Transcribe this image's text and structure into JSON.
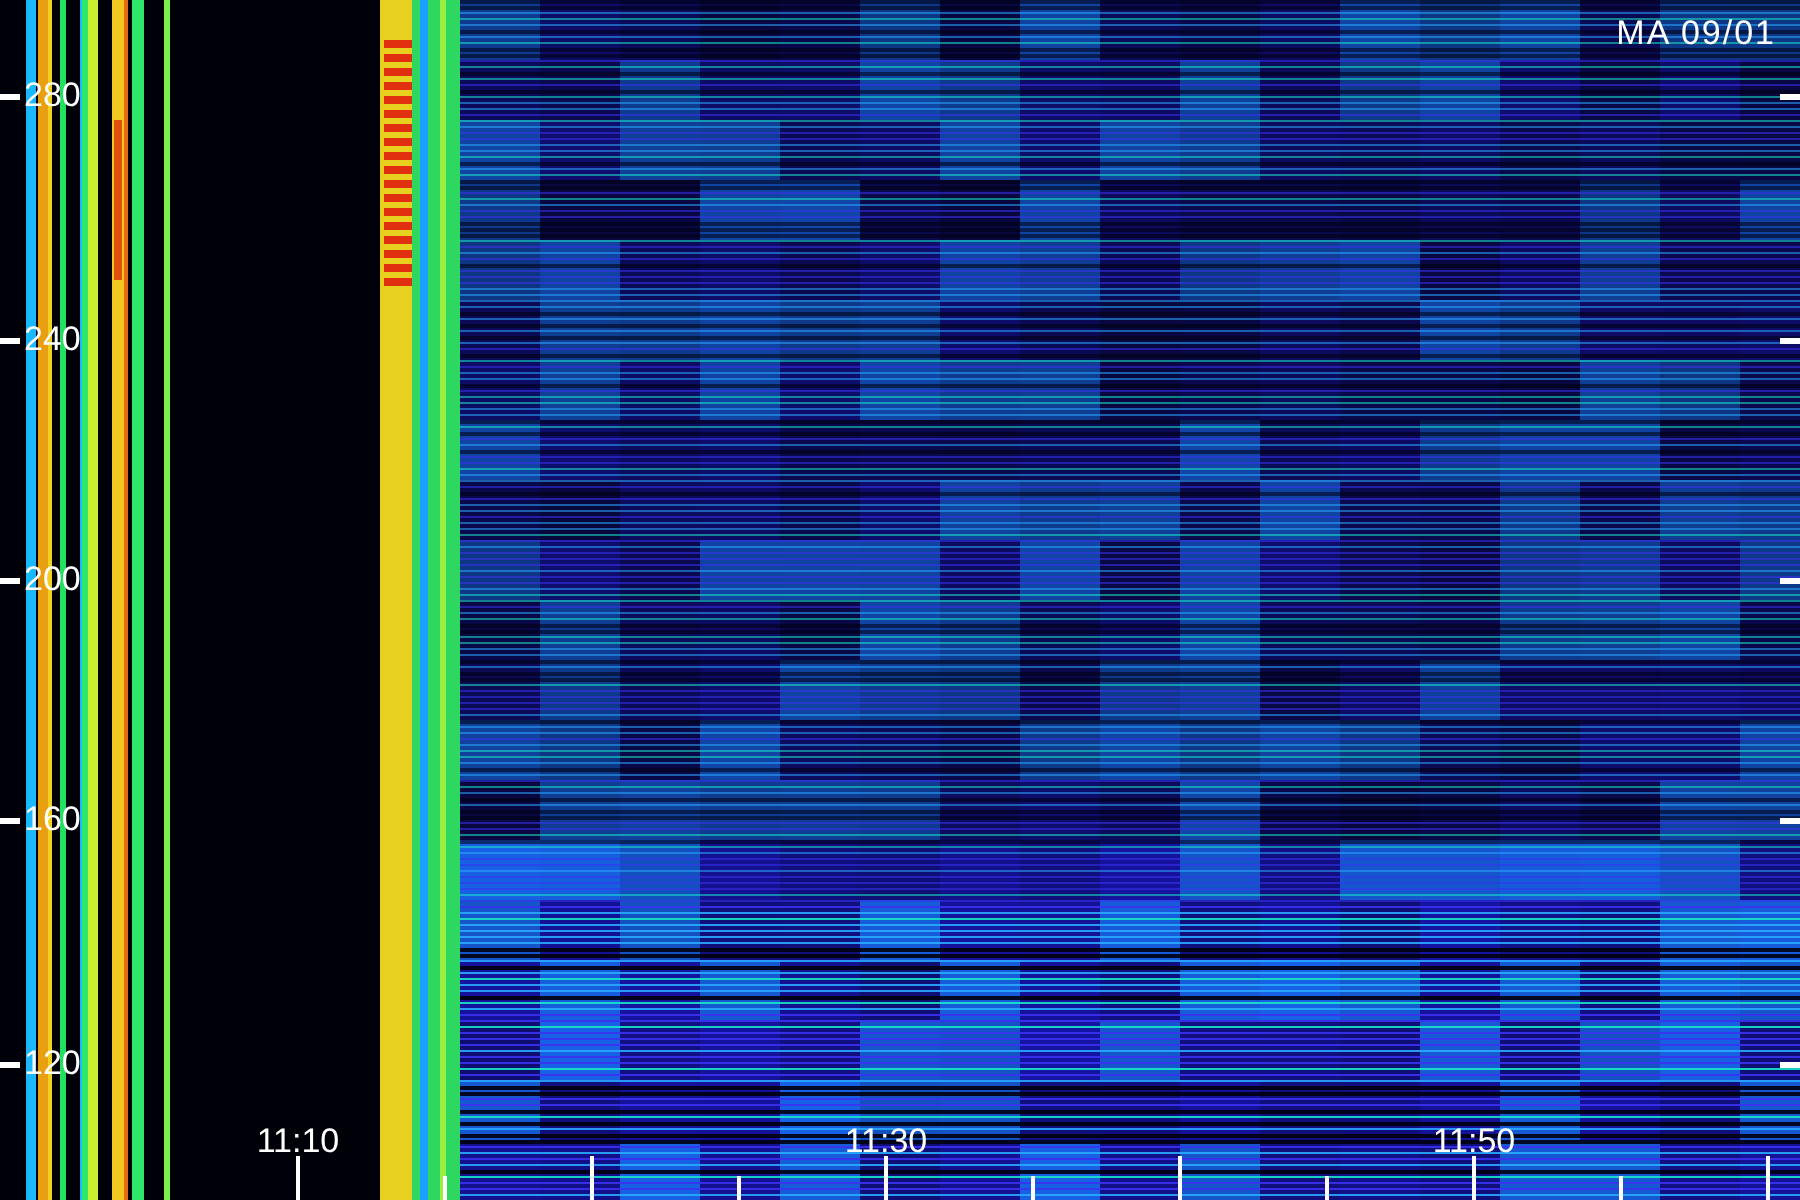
{
  "station_label": "MA 09/01",
  "frequency_axis": {
    "labels": [
      "280",
      "240",
      "200",
      "160",
      "120"
    ]
  },
  "time_axis": {
    "labels": [
      "11:10",
      "11:30",
      "11:50"
    ]
  }
}
